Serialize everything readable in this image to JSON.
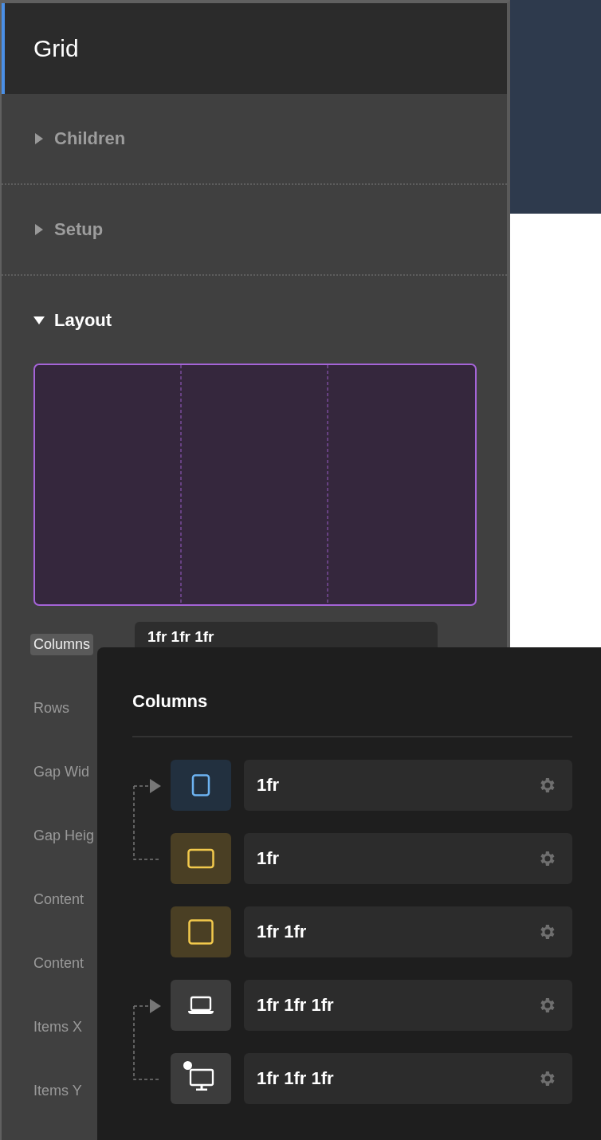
{
  "panel": {
    "title": "Grid",
    "sections": [
      {
        "label": "Children",
        "expanded": false
      },
      {
        "label": "Setup",
        "expanded": false
      },
      {
        "label": "Layout",
        "expanded": true
      }
    ],
    "properties": [
      {
        "label": "Columns",
        "selected": true,
        "value": "1fr 1fr 1fr"
      },
      {
        "label": "Rows",
        "selected": false
      },
      {
        "label": "Gap Wid",
        "selected": false
      },
      {
        "label": "Gap Heig",
        "selected": false
      },
      {
        "label": "Content",
        "selected": false
      },
      {
        "label": "Content",
        "selected": false
      },
      {
        "label": "Items X",
        "selected": false
      },
      {
        "label": "Items Y",
        "selected": false
      }
    ]
  },
  "popover": {
    "title": "Columns",
    "rows": [
      {
        "kind": "tablet-portrait",
        "color": "#6db3f2",
        "inherits_below": true,
        "dot": false,
        "value": "1fr"
      },
      {
        "kind": "tablet-landscape",
        "color": "#f2c94c",
        "inherits_below": false,
        "dot": false,
        "value": "1fr"
      },
      {
        "kind": "square",
        "color": "#f2c94c",
        "inherits_below": false,
        "dot": false,
        "value": "1fr 1fr"
      },
      {
        "kind": "laptop",
        "color": "#ffffff",
        "inherits_below": true,
        "dot": false,
        "value": "1fr 1fr 1fr"
      },
      {
        "kind": "desktop",
        "color": "#ffffff",
        "inherits_below": false,
        "dot": true,
        "value": "1fr 1fr 1fr"
      }
    ]
  }
}
